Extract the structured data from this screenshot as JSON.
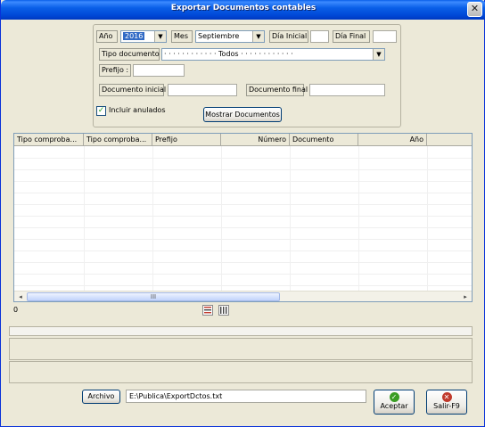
{
  "window": {
    "title": "Exportar Documentos contables",
    "close_icon": "close-icon"
  },
  "filters": {
    "anio_label": "Año",
    "anio_value": "2016",
    "mes_label": "Mes",
    "mes_value": "Septiembre",
    "dia_inicial_label": "Día Inicial",
    "dia_inicial_value": "",
    "dia_final_label": "Día Final",
    "dia_final_value": "",
    "tipo_documento_label": "Tipo documento",
    "tipo_documento_value": "· · · · · · · · · · · · Todos · · · · · · · · · · · ·",
    "prefijo_label": "Prefijo :",
    "prefijo_value": "",
    "doc_inicial_label": "Documento  inicial",
    "doc_inicial_value": "",
    "doc_final_label": "Documento final",
    "doc_final_value": "",
    "incluir_anulados_label": "Incluir anulados",
    "incluir_anulados_checked": true,
    "mostrar_button": "Mostrar Documentos"
  },
  "table": {
    "columns": [
      "Tipo comproba...",
      "Tipo comproba...",
      "Prefijo",
      "Número",
      "Documento",
      "Año"
    ],
    "rows": [],
    "scroll_thumb_label": "III"
  },
  "count_label": "0",
  "footer": {
    "archivo_button": "Archivo",
    "archivo_path": "E:\\Publica\\ExportDctos.txt",
    "aceptar_button": "Aceptar",
    "salir_button": "Salir-F9"
  }
}
